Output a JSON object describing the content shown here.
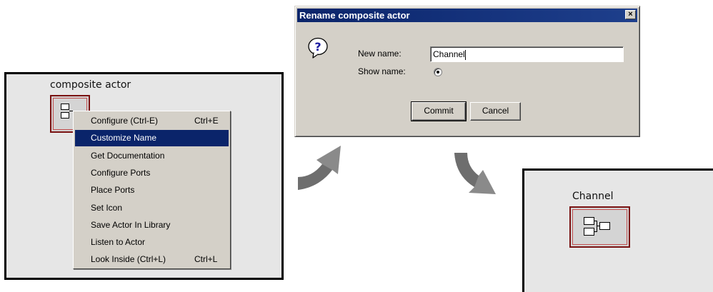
{
  "left_panel": {
    "actor_label": "composite actor"
  },
  "context_menu": {
    "items": [
      {
        "label": "Configure (Ctrl-E)",
        "shortcut": "Ctrl+E",
        "selected": false
      },
      {
        "label": "Customize Name",
        "shortcut": "",
        "selected": true
      },
      {
        "label": "Get Documentation",
        "shortcut": "",
        "selected": false
      },
      {
        "label": "Configure Ports",
        "shortcut": "",
        "selected": false
      },
      {
        "label": "Place Ports",
        "shortcut": "",
        "selected": false
      },
      {
        "label": "Set Icon",
        "shortcut": "",
        "selected": false
      },
      {
        "label": "Save Actor In Library",
        "shortcut": "",
        "selected": false
      },
      {
        "label": "Listen to Actor",
        "shortcut": "",
        "selected": false
      },
      {
        "label": "Look Inside (Ctrl+L)",
        "shortcut": "Ctrl+L",
        "selected": false
      }
    ],
    "highlight_color": "#0a246a"
  },
  "dialog": {
    "title": "Rename composite actor",
    "close_glyph": "×",
    "icon": "question-icon",
    "new_name_label": "New name:",
    "new_name_value": "Channel",
    "show_name_label": "Show name:",
    "show_name_checked": true,
    "commit_label": "Commit",
    "cancel_label": "Cancel"
  },
  "right_panel": {
    "actor_label": "Channel"
  },
  "colors": {
    "actor_border": "#7a1212",
    "canvas_bg": "#e6e6e6",
    "arrow": "#808080"
  }
}
